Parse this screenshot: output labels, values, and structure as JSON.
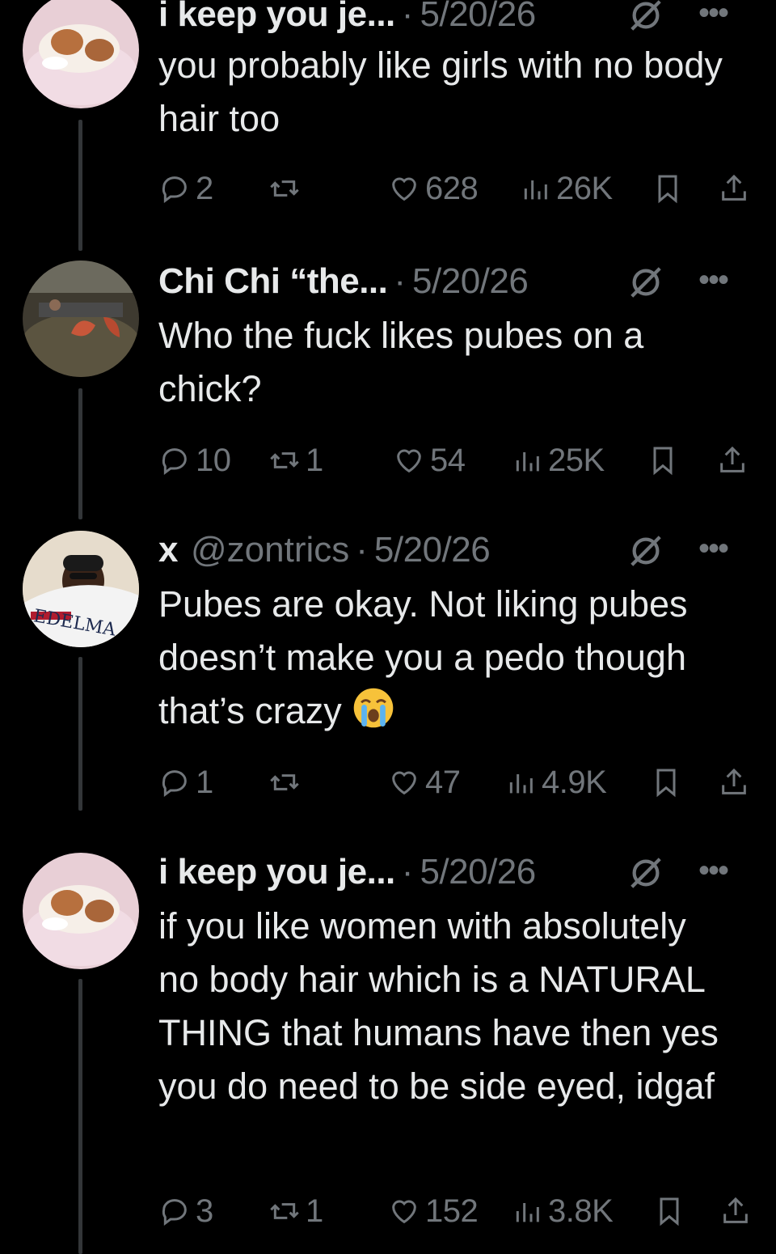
{
  "tweets": [
    {
      "name": "i keep you je...",
      "handle": "",
      "date": "5/20/26",
      "text": "you probably like girls with no body hair too",
      "replies": "2",
      "reposts": "",
      "likes": "628",
      "views": "26K"
    },
    {
      "name": "Chi Chi “the...",
      "handle": "",
      "date": "5/20/26",
      "text": "Who the fuck likes pubes on a chick?",
      "replies": "10",
      "reposts": "1",
      "likes": "54",
      "views": "25K"
    },
    {
      "name": "x",
      "handle": "@zontrics",
      "date": "5/20/26",
      "text": "Pubes are okay. Not liking pubes doesn’t make you a pedo though that’s crazy",
      "replies": "1",
      "reposts": "",
      "likes": "47",
      "views": "4.9K"
    },
    {
      "name": "i keep you je...",
      "handle": "",
      "date": "5/20/26",
      "text": "if you like women with absolutely no body hair which is a NATURAL THING that humans have then yes you do need to be side eyed, idgaf",
      "replies": "3",
      "reposts": "1",
      "likes": "152",
      "views": "3.8K"
    }
  ],
  "separator": "·",
  "more_label": "•••",
  "icons": [
    "reply-icon",
    "repost-icon",
    "like-icon",
    "views-icon",
    "bookmark-icon",
    "share-icon",
    "grok-icon",
    "more-icon",
    "loudly-crying-face-emoji"
  ],
  "colors": {
    "background": "#000000",
    "text": "#e7e9ea",
    "muted": "#71767b",
    "thread_line": "#333639"
  }
}
